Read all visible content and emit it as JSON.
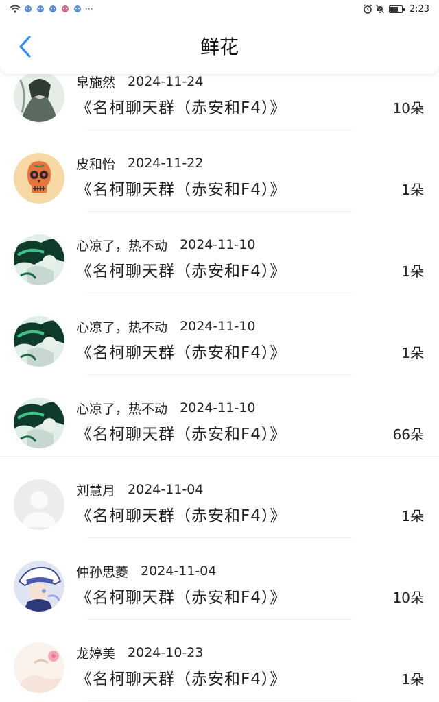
{
  "status_bar": {
    "time": "2:23",
    "left_icons": [
      "wifi-icon",
      "app-notification-icon",
      "app-notification-icon",
      "app-notification-icon",
      "app-notification-icon",
      "app-notification-icon",
      "more-icon"
    ],
    "right_icons": [
      "alarm-icon",
      "mute-icon",
      "battery-icon"
    ]
  },
  "header": {
    "title": "鲜花",
    "back_icon": "chevron-left-icon",
    "accent_color": "#2f8ff5"
  },
  "records": [
    {
      "name": "皐施然",
      "date": "2024-11-24",
      "group": "《名柯聊天群（赤安和F4）》",
      "count": "10朵",
      "avatar": "green-ink-avatar"
    },
    {
      "name": "皮和怡",
      "date": "2024-11-22",
      "group": "《名柯聊天群（赤安和F4）》",
      "count": "1朵",
      "avatar": "sugar-skull-avatar"
    },
    {
      "name": "心凉了，热不动",
      "date": "2024-11-10",
      "group": "《名柯聊天群（赤安和F4）》",
      "count": "1朵",
      "avatar": "anime-green-avatar"
    },
    {
      "name": "心凉了，热不动",
      "date": "2024-11-10",
      "group": "《名柯聊天群（赤安和F4）》",
      "count": "1朵",
      "avatar": "anime-green-avatar"
    },
    {
      "name": "心凉了，热不动",
      "date": "2024-11-10",
      "group": "《名柯聊天群（赤安和F4）》",
      "count": "66朵",
      "avatar": "anime-green-avatar"
    },
    {
      "name": "刘慧月",
      "date": "2024-11-04",
      "group": "《名柯聊天群（赤安和F4）》",
      "count": "1朵",
      "avatar": "default-avatar"
    },
    {
      "name": "仲孙思菱",
      "date": "2024-11-04",
      "group": "《名柯聊天群（赤安和F4）》",
      "count": "10朵",
      "avatar": "kaito-kid-avatar"
    },
    {
      "name": "龙婷美",
      "date": "2024-10-23",
      "group": "《名柯聊天群（赤安和F4）》",
      "count": "1朵",
      "avatar": "pink-flower-avatar"
    }
  ]
}
